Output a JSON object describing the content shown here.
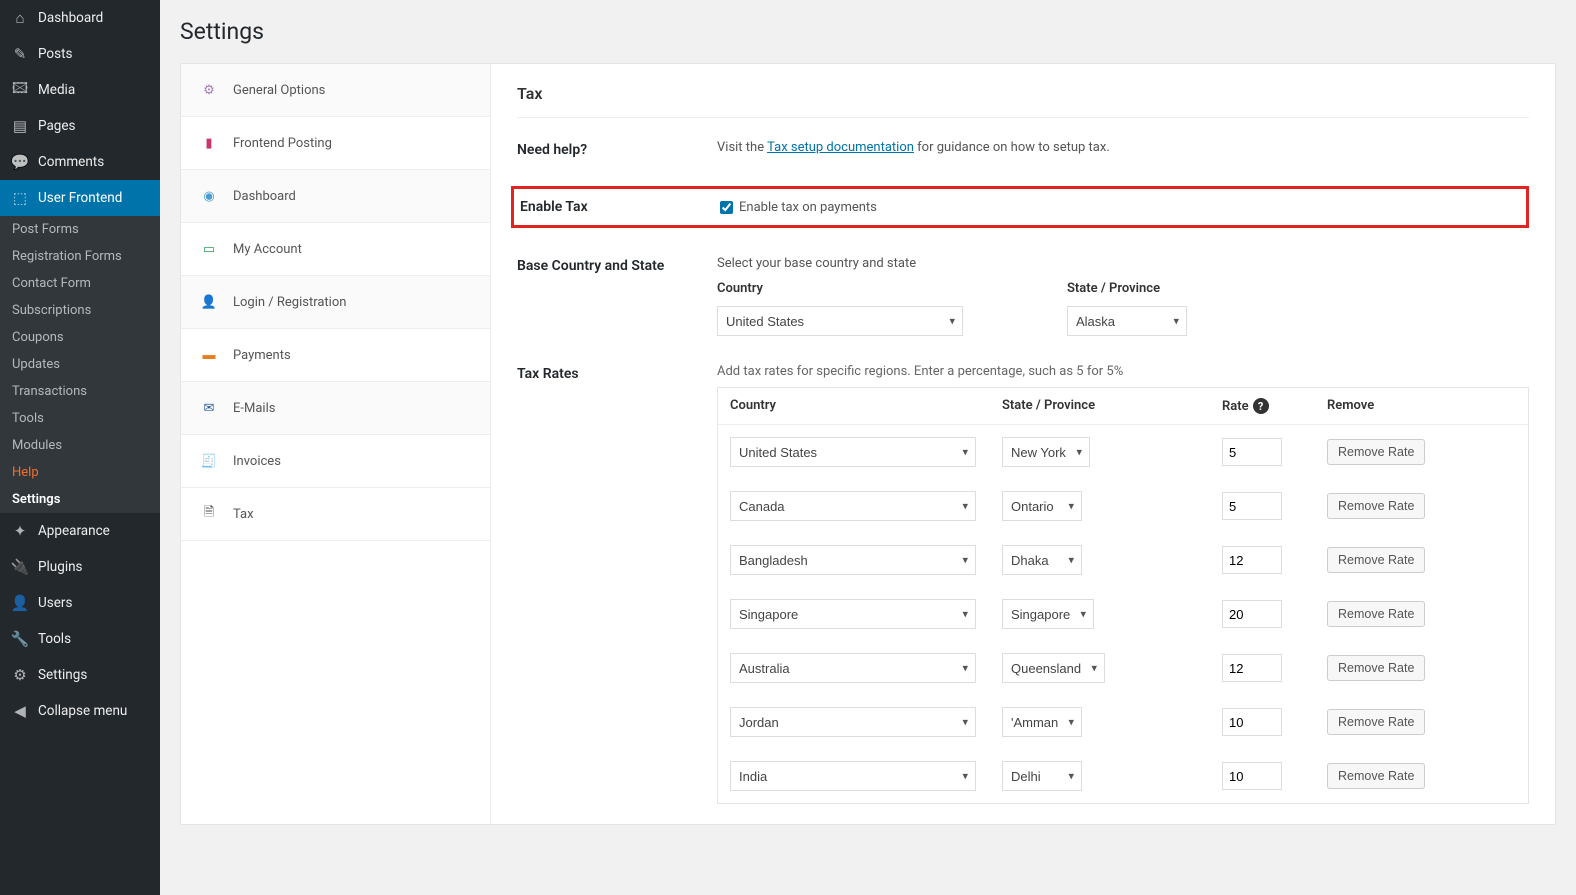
{
  "sidebar": {
    "items": [
      {
        "icon": "⌂",
        "label": "Dashboard"
      },
      {
        "icon": "✎",
        "label": "Posts"
      },
      {
        "icon": "🖾",
        "label": "Media"
      },
      {
        "icon": "▤",
        "label": "Pages"
      },
      {
        "icon": "💬",
        "label": "Comments"
      },
      {
        "icon": "⬚",
        "label": "User Frontend"
      }
    ],
    "subitems": [
      {
        "label": "Post Forms"
      },
      {
        "label": "Registration Forms"
      },
      {
        "label": "Contact Form"
      },
      {
        "label": "Subscriptions"
      },
      {
        "label": "Coupons"
      },
      {
        "label": "Updates"
      },
      {
        "label": "Transactions"
      },
      {
        "label": "Tools"
      },
      {
        "label": "Modules"
      },
      {
        "label": "Help"
      },
      {
        "label": "Settings"
      }
    ],
    "items2": [
      {
        "icon": "✦",
        "label": "Appearance"
      },
      {
        "icon": "🔌",
        "label": "Plugins"
      },
      {
        "icon": "👤",
        "label": "Users"
      },
      {
        "icon": "🔧",
        "label": "Tools"
      },
      {
        "icon": "⚙",
        "label": "Settings"
      },
      {
        "icon": "◀",
        "label": "Collapse menu"
      }
    ]
  },
  "page_title": "Settings",
  "settings_nav": [
    {
      "icon": "⚙",
      "color": "#a77cbb",
      "label": "General Options"
    },
    {
      "icon": "▮",
      "color": "#c9356e",
      "label": "Frontend Posting"
    },
    {
      "icon": "◉",
      "color": "#4a9bd4",
      "label": "Dashboard"
    },
    {
      "icon": "▭",
      "color": "#2e9e5b",
      "label": "My Account"
    },
    {
      "icon": "👤",
      "color": "#3b82c4",
      "label": "Login / Registration"
    },
    {
      "icon": "▬",
      "color": "#e67e22",
      "label": "Payments"
    },
    {
      "icon": "✉",
      "color": "#2c5aa0",
      "label": "E-Mails"
    },
    {
      "icon": "🧾",
      "color": "#2e9e5b",
      "label": "Invoices"
    },
    {
      "icon": "🗎",
      "color": "#444",
      "label": "Tax"
    }
  ],
  "tax": {
    "title": "Tax",
    "help_label": "Need help?",
    "help_prefix": "Visit the ",
    "help_link": "Tax setup documentation",
    "help_suffix": " for guidance on how to setup tax.",
    "enable_label": "Enable Tax",
    "enable_checkbox_label": "Enable tax on payments",
    "base_label": "Base Country and State",
    "base_hint": "Select your base country and state",
    "country_header": "Country",
    "state_header": "State / Province",
    "base_country": "United States",
    "base_state": "Alaska",
    "rates_label": "Tax Rates",
    "rates_hint": "Add tax rates for specific regions. Enter a percentage, such as 5 for 5%",
    "rate_header": "Rate",
    "remove_header": "Remove",
    "remove_btn": "Remove Rate",
    "rows": [
      {
        "country": "United States",
        "state": "New York",
        "rate": "5"
      },
      {
        "country": "Canada",
        "state": "Ontario",
        "rate": "5"
      },
      {
        "country": "Bangladesh",
        "state": "Dhaka",
        "rate": "12"
      },
      {
        "country": "Singapore",
        "state": "Singapore",
        "rate": "20"
      },
      {
        "country": "Australia",
        "state": "Queensland",
        "rate": "12"
      },
      {
        "country": "Jordan",
        "state": "'Amman",
        "rate": "10"
      },
      {
        "country": "India",
        "state": "Delhi",
        "rate": "10"
      }
    ]
  }
}
